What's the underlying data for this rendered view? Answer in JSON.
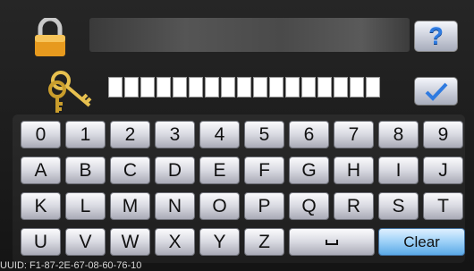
{
  "title_bar": {
    "help_label": "?"
  },
  "password": {
    "cell_count": 17,
    "confirm_icon": "checkmark-icon"
  },
  "keyboard": {
    "rows": [
      [
        "0",
        "1",
        "2",
        "3",
        "4",
        "5",
        "6",
        "7",
        "8",
        "9"
      ],
      [
        "A",
        "B",
        "C",
        "D",
        "E",
        "F",
        "G",
        "H",
        "I",
        "J"
      ],
      [
        "K",
        "L",
        "M",
        "N",
        "O",
        "P",
        "Q",
        "R",
        "S",
        "T"
      ],
      [
        "U",
        "V",
        "W",
        "X",
        "Y",
        "Z"
      ]
    ],
    "space_symbol": "␣",
    "clear_label": "Clear"
  },
  "status": {
    "uuid": "UUID: F1-87-2E-67-08-60-76-10"
  },
  "colors": {
    "clear_key": "#5aa8e6",
    "help_question": "#2f7be0",
    "background": "#1c1c1c"
  }
}
